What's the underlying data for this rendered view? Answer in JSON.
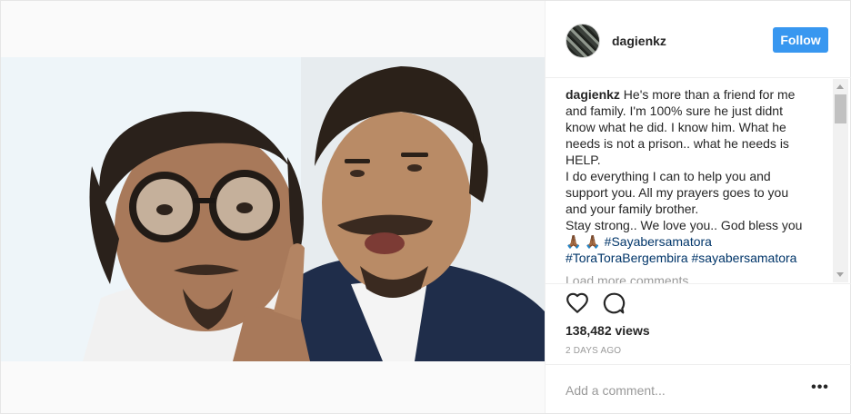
{
  "post": {
    "username": "dagienkz",
    "follow_label": "Follow",
    "caption": {
      "username": "dagienkz",
      "line1": "He's more than a friend for me",
      "line2": "and family. I'm 100% sure he just didnt",
      "line3": "know what he did. I know him. What he",
      "line4": "needs is not a prison.. what he needs is",
      "line5": "HELP.",
      "line6": "I do everything I can to help you and",
      "line7": "support you. All my prayers goes to you",
      "line8": "and your family brother.",
      "line9": "Stay strong.. We love you.. God bless you",
      "emoji": "🙏🏾 🙏🏾",
      "hashtag1": "#Sayabersamatora",
      "hashtag2": "#ToraToraBergembira",
      "hashtag3": "#sayabersamatora"
    },
    "load_more": "Load more comments",
    "views": "138,482 views",
    "time": "2 DAYS AGO",
    "comment_placeholder": "Add a comment...",
    "more_label": "•••"
  },
  "icons": {
    "like": "heart-icon",
    "comment": "comment-bubble-icon",
    "more": "more-dots-icon"
  },
  "colors": {
    "follow_button": "#3897f0",
    "hashtag": "#003569",
    "muted": "#999999",
    "text": "#262626"
  }
}
